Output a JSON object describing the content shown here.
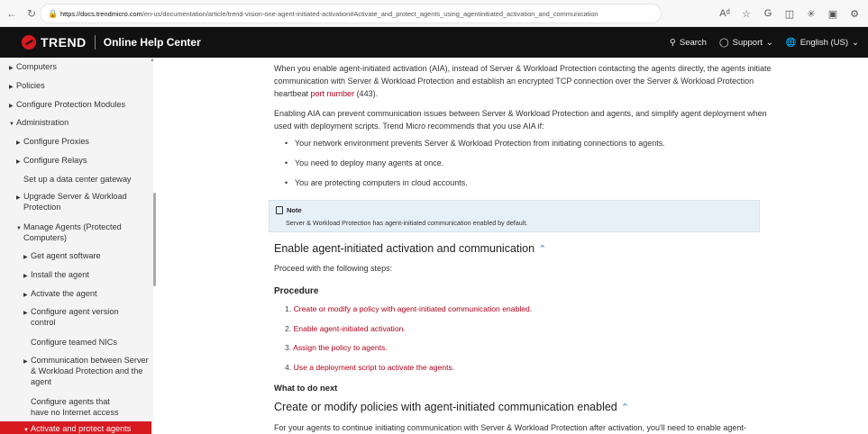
{
  "browser": {
    "url_host": "https://docs.trendmicro.com",
    "url_path": "/en-us/documentation/article/trend-vision-one-agent-initiated-activation#Activate_and_protect_agents_using_agentinitiated_activation_and_communication"
  },
  "header": {
    "logo": "TREND",
    "title": "Online Help Center",
    "search": "Search",
    "support": "Support",
    "language": "English (US)"
  },
  "sidebar": {
    "items": [
      {
        "label": "Computers"
      },
      {
        "label": "Policies"
      },
      {
        "label": "Configure Protection Modules"
      },
      {
        "label": "Administration"
      },
      {
        "label": "Configure Proxies"
      },
      {
        "label": "Configure Relays"
      },
      {
        "label": "Set up a data center gateway"
      },
      {
        "label": "Upgrade Server & Workload Protection"
      },
      {
        "label": "Manage Agents (Protected Computers)"
      },
      {
        "label": "Get agent software"
      },
      {
        "label": "Install the agent"
      },
      {
        "label": "Activate the agent"
      },
      {
        "label": "Configure agent version control"
      },
      {
        "label": "Configure teamed NICs"
      },
      {
        "label": "Communication between Server & Workload Protection and the agent"
      },
      {
        "label": "Configure agents that have no Internet access"
      },
      {
        "label": "Activate and protect agents"
      }
    ]
  },
  "content": {
    "intro_1a": "When you enable agent-initiated activation (AIA), instead of Server & Workload Protection contacting the agents directly, the agents initiate",
    "intro_1b": "communication with Server & Workload Protection and establish an encrypted TCP connection over the Server & Workload Protection",
    "intro_1c_pre": "heartbeat ",
    "intro_1c_link": "port number",
    "intro_1c_post": " (443).",
    "intro_2a": "Enabling AIA can prevent communication issues between Server & Workload Protection and agents, and simplify agent deployment when",
    "intro_2b": "used with deployment scripts. Trend Micro recommends that you use AIA if:",
    "bullets": [
      "Your network environment prevents Server & Workload Protection from initiating connections to agents.",
      "You need to deploy many agents at once.",
      "You are protecting computers in cloud accounts."
    ],
    "note_title": "Note",
    "note_text": "Server & Workload Protection has agent-initiated communication enabled by default.",
    "heading_1": "Enable agent-initiated activation and communication",
    "steps_intro": "Proceed with the following steps:",
    "procedure": "Procedure",
    "steps": [
      {
        "num": "1.",
        "text": "Create or modify a policy with agent-initiated communication enabled."
      },
      {
        "num": "2.",
        "text": "Enable agent-initiated activation."
      },
      {
        "num": "3.",
        "text": "Assign the policy to agents."
      },
      {
        "num": "4.",
        "text": "Use a deployment script to activate the agents."
      }
    ],
    "what_next": "What to do next",
    "heading_2": "Create or modify policies with agent-initiated communication enabled",
    "last_para": "For your agents to continue initiating communication with Server & Workload Protection after activation, you'll need to enable agent-"
  }
}
